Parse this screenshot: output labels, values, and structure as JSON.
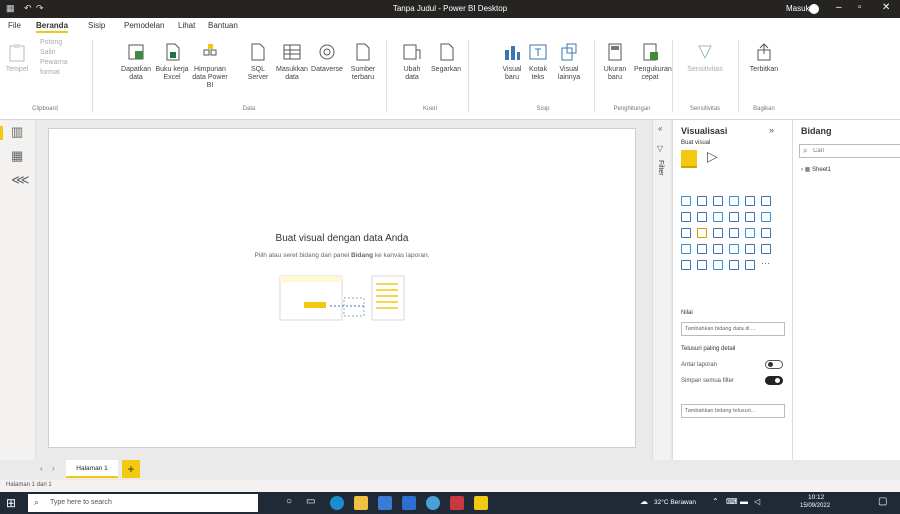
{
  "window": {
    "title": "Tanpa Judul - Power BI Desktop",
    "user": "Masuk"
  },
  "menu": [
    "File",
    "Beranda",
    "Sisip",
    "Pemodelan",
    "Lihat",
    "Bantuan"
  ],
  "ribbon": {
    "clipboard": [
      "Tempel",
      "Potong",
      "Salin",
      "Pewarna format"
    ],
    "clipboard_group": "Clipboard",
    "data_buttons": [
      {
        "label": "Dapatkan data",
        "name": "get-data-button"
      },
      {
        "label": "Buku kerja Excel",
        "name": "excel-workbook-button"
      },
      {
        "label": "Himpunan data Power BI",
        "name": "powerbi-datasets-button"
      },
      {
        "label": "SQL Server",
        "name": "sql-server-button"
      },
      {
        "label": "Masukkan data",
        "name": "enter-data-button"
      },
      {
        "label": "Dataverse",
        "name": "dataverse-button"
      },
      {
        "label": "Sumber terbaru",
        "name": "recent-sources-button"
      }
    ],
    "data_group": "Data",
    "query_buttons": [
      {
        "label": "Ubah data",
        "name": "transform-data-button"
      },
      {
        "label": "Segarkan",
        "name": "refresh-button"
      }
    ],
    "query_group": "Kueri",
    "insert_buttons": [
      {
        "label": "Visual baru",
        "name": "new-visual-button"
      },
      {
        "label": "Kotak teks",
        "name": "text-box-button"
      },
      {
        "label": "Visual lainnya",
        "name": "more-visuals-button"
      }
    ],
    "insert_group": "Sisip",
    "calc_buttons": [
      {
        "label": "Ukuran baru",
        "name": "new-measure-button"
      },
      {
        "label": "Pengukuran cepat",
        "name": "quick-measure-button"
      }
    ],
    "calc_group": "Penghitungan",
    "sens_label": "Sensitivitas",
    "sens_group": "Sensitivitas",
    "share_label": "Terbitkan",
    "share_group": "Bagikan"
  },
  "canvas": {
    "title": "Buat visual dengan data Anda",
    "subtitle_pre": "Pilih atau seret bidang dari panel ",
    "subtitle_bold": "Bidang",
    "subtitle_post": " ke kanvas laporan."
  },
  "filters_label": "Filter",
  "viz": {
    "title": "Visualisasi",
    "build": "Buat visual",
    "values": "Nilai",
    "add_data": "Tambahkan bidang data di ...",
    "drill": "Telusuri paling detail",
    "cross_report": "Antar laporan",
    "cross_state": "Mati",
    "keep_filters": "Simpan semua filter",
    "keep_state": "Aktif",
    "add_drill": "Tambahkan bidang telusuri..."
  },
  "fields": {
    "title": "Bidang",
    "search_placeholder": "Cari",
    "tables": [
      "Sheet1"
    ]
  },
  "pages": {
    "tab": "Halaman 1",
    "add": "+"
  },
  "status": "Halaman 1 dari 1",
  "taskbar": {
    "search_placeholder": "Type here to search",
    "weather": "32°C Berawan",
    "time": "10:12",
    "date": "15/09/2022"
  },
  "colors": {
    "accent": "#f2c811",
    "titlebar": "#252423",
    "taskbar": "#1f2a36"
  }
}
